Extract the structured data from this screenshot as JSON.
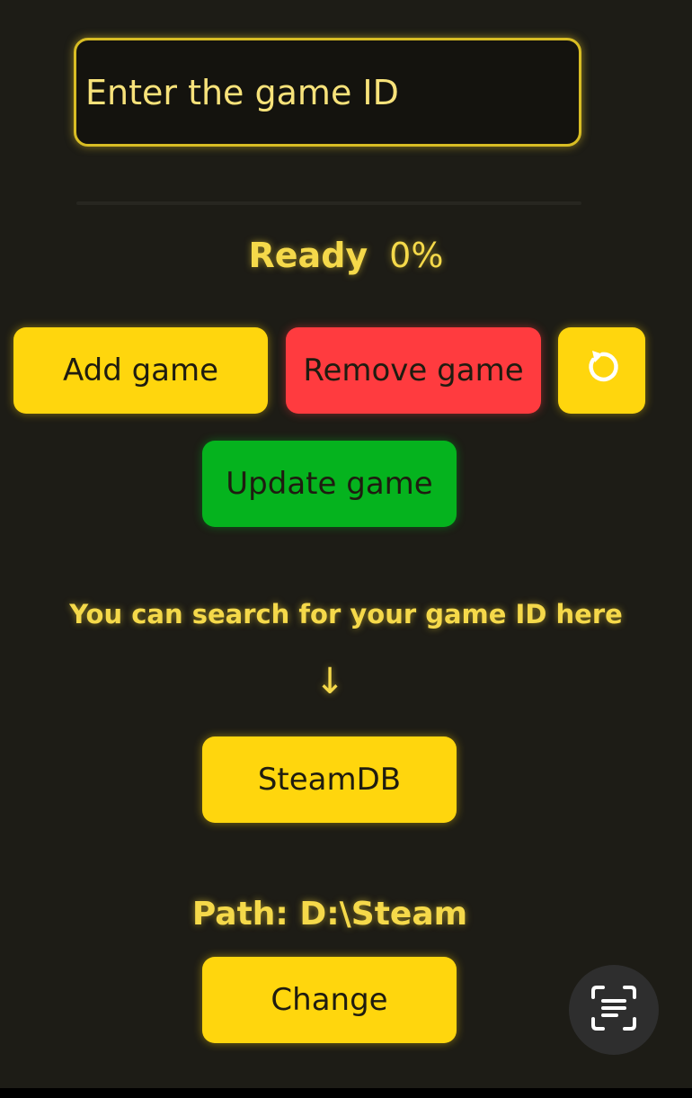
{
  "game_id": {
    "placeholder": "Enter the game ID",
    "value": ""
  },
  "status": {
    "text": "Ready",
    "progress": "0%"
  },
  "buttons": {
    "add": "Add game",
    "remove": "Remove game",
    "update": "Update game",
    "steamdb": "SteamDB",
    "change": "Change"
  },
  "search_hint": "You can search for your game ID here",
  "arrow_glyph": "↓",
  "path": "Path: D:\\Steam",
  "icons": {
    "refresh": "refresh-icon",
    "scan": "text-scan-icon"
  },
  "colors": {
    "background": "#1d1c16",
    "accent_yellow": "#ffd60d",
    "danger_red": "#ff3b3f",
    "success_green": "#05b31e",
    "text_yellow": "#f5d94a"
  }
}
